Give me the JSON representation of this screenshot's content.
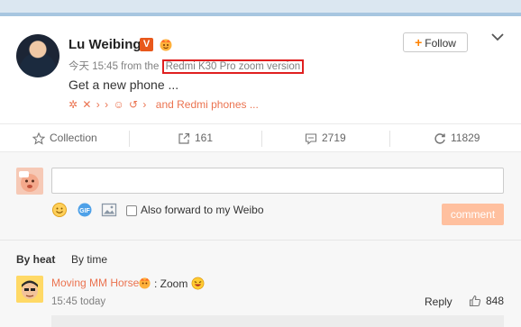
{
  "post": {
    "username": "Lu Weibing",
    "verified_badge": "V",
    "follow_label": "Follow",
    "time_prefix": "今天 15:45 from the",
    "source": "Redmi K30 Pro zoom version",
    "text": "Get a new phone ...",
    "emoji_glyphs": "✲ ✕ › › ☺ ↺ ›",
    "emoji_more": "and Redmi phones ..."
  },
  "actions": {
    "collection_label": "Collection",
    "forward_count": "161",
    "comment_count": "2719",
    "like_count": "11829"
  },
  "compose": {
    "input_placeholder": "",
    "forward_label": "Also forward to my Weibo",
    "comment_button": "comment"
  },
  "sort": {
    "by_heat": "By heat",
    "by_time": "By time"
  },
  "comment": {
    "user": "Moving MM Horse",
    "text": ": Zoom",
    "time": "15:45 today",
    "reply_label": "Reply",
    "like_count": "848"
  },
  "colors": {
    "accent_orange": "#ff8200",
    "link_orange": "#eb7350",
    "source_highlight": "#e02020",
    "comment_button_bg": "#ffc09f"
  },
  "icons": [
    "chevron-down-icon",
    "star-icon",
    "share-icon",
    "comment-icon",
    "repost-icon",
    "smile-icon",
    "gif-icon",
    "image-icon",
    "thumbs-up-icon",
    "crown-icon"
  ]
}
